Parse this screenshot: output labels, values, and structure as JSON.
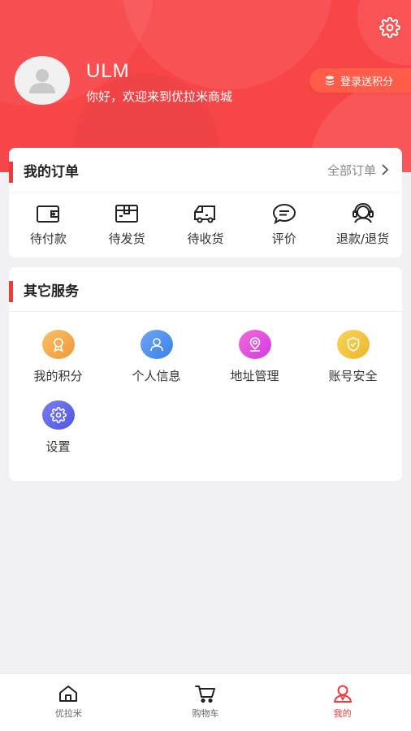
{
  "colors": {
    "brand": "#f84648",
    "accent": "#f03a3a"
  },
  "header": {
    "username": "ULM",
    "welcome": "你好，欢迎来到优拉米商城",
    "points_button": "登录送积分",
    "settings_icon": "gear-icon"
  },
  "orders": {
    "title": "我的订单",
    "all_orders": "全部订单",
    "items": [
      {
        "label": "待付款",
        "icon": "wallet-icon"
      },
      {
        "label": "待发货",
        "icon": "package-icon"
      },
      {
        "label": "待收货",
        "icon": "truck-icon"
      },
      {
        "label": "评价",
        "icon": "comment-icon"
      },
      {
        "label": "退款/退货",
        "icon": "support-icon"
      }
    ]
  },
  "services": {
    "title": "其它服务",
    "items": [
      {
        "label": "我的积分",
        "icon": "medal-icon",
        "color": "#f6a548"
      },
      {
        "label": "个人信息",
        "icon": "user-icon",
        "color": "#4c8df0"
      },
      {
        "label": "地址管理",
        "icon": "location-icon",
        "color": "#e848d8"
      },
      {
        "label": "账号安全",
        "icon": "shield-icon",
        "color": "#f4c23b"
      },
      {
        "label": "设置",
        "icon": "gear-icon",
        "color": "#5e66e8"
      }
    ]
  },
  "tabbar": {
    "items": [
      {
        "label": "优拉米",
        "icon": "home-icon"
      },
      {
        "label": "购物车",
        "icon": "cart-icon"
      },
      {
        "label": "我的",
        "icon": "profile-icon",
        "active": true
      }
    ]
  }
}
